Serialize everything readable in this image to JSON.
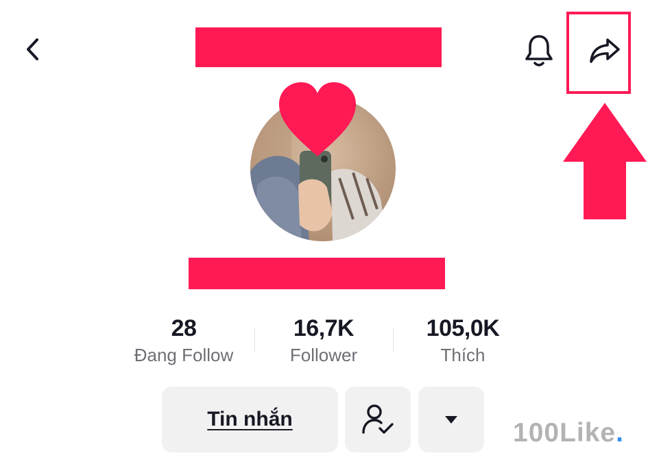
{
  "header": {
    "back_icon": "chevron-left-icon",
    "notification_icon": "bell-icon",
    "share_icon": "share-arrow-icon"
  },
  "annotations": {
    "highlight_color": "#ff1a55",
    "arrow_icon": "arrow-up-icon",
    "heart_icon": "heart-icon"
  },
  "stats": [
    {
      "value": "28",
      "label": "Đang Follow"
    },
    {
      "value": "16,7K",
      "label": "Follower"
    },
    {
      "value": "105,0K",
      "label": "Thích"
    }
  ],
  "actions": {
    "message_label": "Tin nhắn",
    "friend_icon": "user-check-icon",
    "more_icon": "caret-down-icon"
  },
  "watermark": {
    "text": "100Like",
    "dot": "."
  }
}
